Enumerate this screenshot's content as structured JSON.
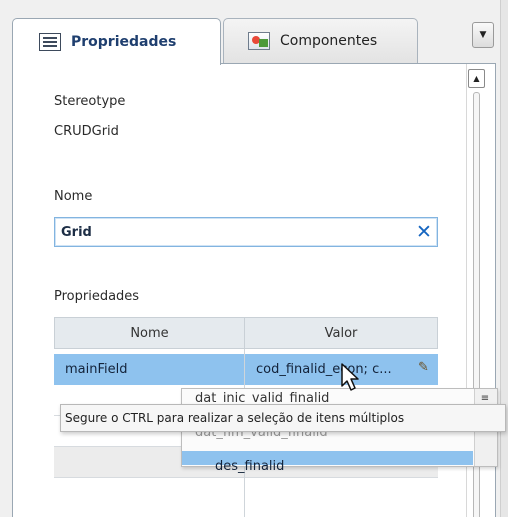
{
  "tabs": [
    {
      "label": "Propriedades",
      "icon": "properties-icon",
      "active": true
    },
    {
      "label": "Componentes",
      "icon": "components-icon",
      "active": false
    }
  ],
  "fields": {
    "stereotype_label": "Stereotype",
    "stereotype_value": "CRUDGrid",
    "name_label": "Nome",
    "name_value": "Grid",
    "props_label": "Propriedades"
  },
  "table": {
    "headers": [
      "Nome",
      "Valor"
    ],
    "rows": [
      {
        "name": "mainField",
        "value": "cod_finalid_econ; c..."
      }
    ]
  },
  "popup": {
    "items": [
      "dat_inic_valid_finalid",
      "dat_fim_valid_finalid",
      "des_finalid"
    ]
  },
  "tooltip": {
    "text": "Segure o CTRL para realizar a seleção de itens múltiplos"
  },
  "colors": {
    "selection": "#8ec2ee",
    "accent": "#1565c0"
  }
}
